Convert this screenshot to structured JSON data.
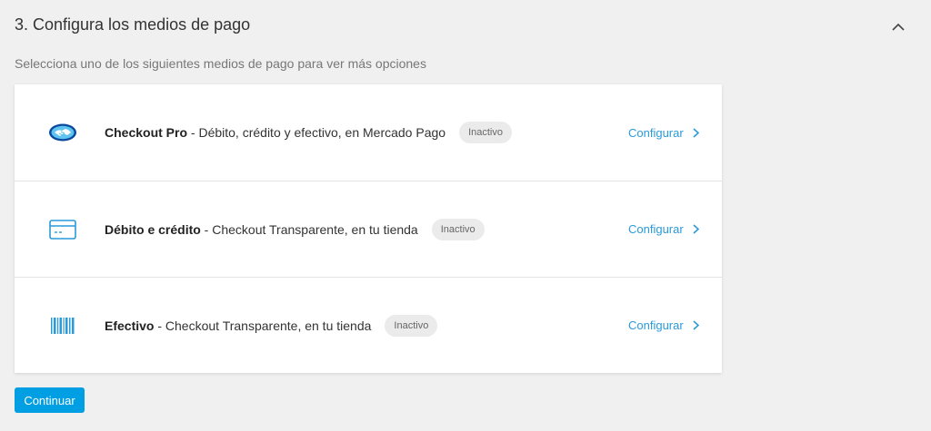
{
  "section": {
    "title": "3. Configura los medios de pago",
    "subtitle": "Selecciona uno de los siguientes medios de pago para ver más opciones",
    "collapse_icon": "chevron-up-icon"
  },
  "payment_methods": [
    {
      "icon": "handshake-icon",
      "name": "Checkout Pro",
      "description": " - Débito, crédito y efectivo, en Mercado Pago",
      "status": "Inactivo",
      "action": "Configurar"
    },
    {
      "icon": "credit-card-icon",
      "name": "Débito e crédito",
      "description": " - Checkout Transparente, en tu tienda",
      "status": "Inactivo",
      "action": "Configurar"
    },
    {
      "icon": "barcode-icon",
      "name": "Efectivo",
      "description": " - Checkout Transparente, en tu tienda",
      "status": "Inactivo",
      "action": "Configurar"
    }
  ],
  "footer": {
    "continue_label": "Continuar"
  },
  "colors": {
    "accent": "#009ee3",
    "link": "#2a9ad8",
    "background": "#f0f0f0"
  }
}
